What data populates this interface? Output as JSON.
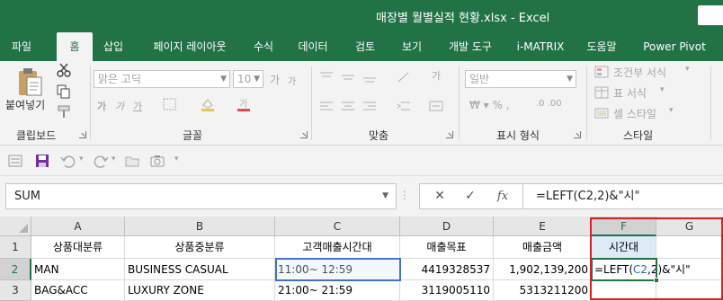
{
  "window": {
    "title": "매장별 월별실적 현황.xlsx  -  Excel"
  },
  "tabs": [
    {
      "label": "파일",
      "active": false
    },
    {
      "label": "홈",
      "active": true
    },
    {
      "label": "삽입",
      "active": false
    },
    {
      "label": "페이지 레이아웃",
      "active": false
    },
    {
      "label": "수식",
      "active": false
    },
    {
      "label": "데이터",
      "active": false
    },
    {
      "label": "검토",
      "active": false
    },
    {
      "label": "보기",
      "active": false
    },
    {
      "label": "개발 도구",
      "active": false
    },
    {
      "label": "i-MATRIX",
      "active": false
    },
    {
      "label": "도움말",
      "active": false
    },
    {
      "label": "Power Pivot",
      "active": false
    }
  ],
  "ribbon": {
    "clipboard": {
      "paste_label": "붙여넣기",
      "group_label": "클립보드"
    },
    "font": {
      "font_name": "맑은 고딕",
      "font_size": "10",
      "group_label": "글꼴",
      "bold": "가",
      "italic": "가",
      "underline": "가",
      "grow": "가",
      "shrink": "가"
    },
    "alignment": {
      "group_label": "맞춤",
      "wrap": "가"
    },
    "number": {
      "format": "일반",
      "group_label": "표시 형식"
    },
    "styles": {
      "group_label": "스타일",
      "conditional": "조건부 서식",
      "table": "표 서식",
      "cell_styles": "셀 스타일"
    }
  },
  "formula_bar": {
    "name_box": "SUM",
    "formula": "=LEFT(C2,2)&\"시\"",
    "cancel": "✕",
    "enter": "✓",
    "fx": "fx"
  },
  "sheet": {
    "columns": [
      "A",
      "B",
      "C",
      "D",
      "E",
      "F",
      "G"
    ],
    "selected_column": "F",
    "selected_row": "2",
    "rows": [
      {
        "num": "1",
        "cells": [
          "상품대분류",
          "상품중분류",
          "고객매출시간대",
          "매출목표",
          "매출금액",
          "시간대",
          ""
        ]
      },
      {
        "num": "2",
        "cells": [
          "MAN",
          "BUSINESS CASUAL",
          "11:00~ 12:59",
          "4419328537",
          "1,902,139,200",
          "",
          ""
        ]
      },
      {
        "num": "3",
        "cells": [
          "BAG&ACC",
          "LUXURY ZONE",
          "21:00~ 21:59",
          "3119005110",
          "5313211200",
          "",
          ""
        ]
      }
    ],
    "editing_cell": {
      "prefix": "=LEFT(",
      "ref": "C2",
      "suffix": ",2)&\"시\""
    }
  },
  "colors": {
    "accent": "#217346",
    "header_fill": "#ddebf7",
    "reference": "#4472c4",
    "highlight": "#e02020"
  }
}
